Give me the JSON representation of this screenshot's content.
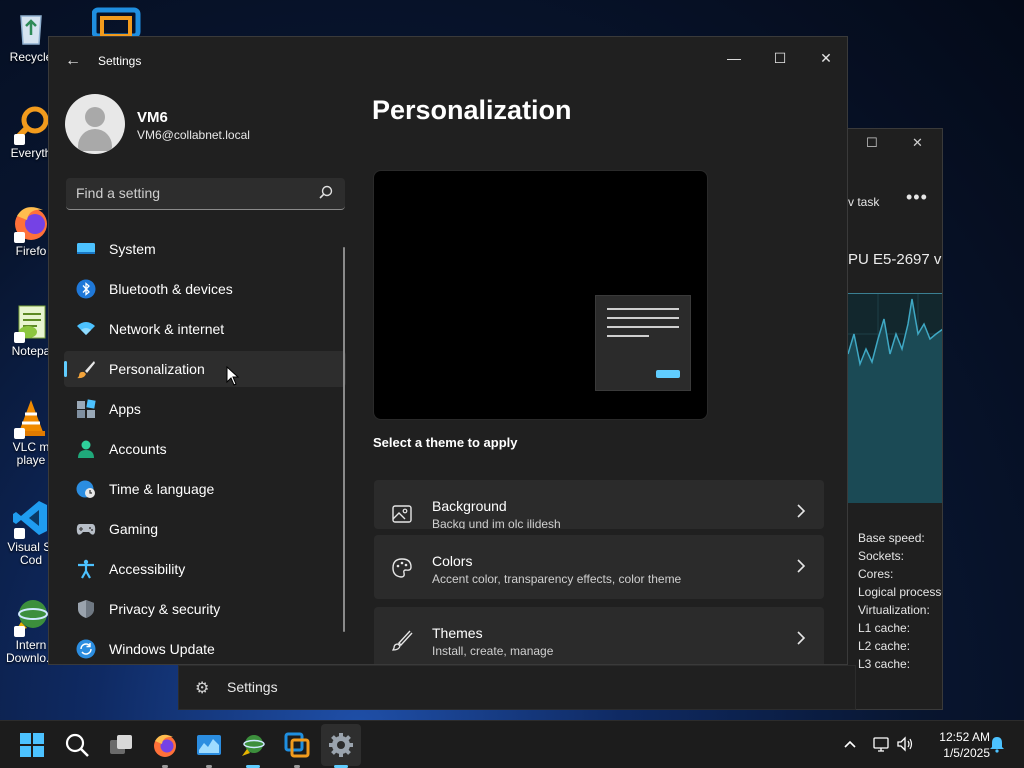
{
  "desktop": {
    "icons": [
      {
        "label": "Recycle"
      },
      {
        "label": "Everyth"
      },
      {
        "label": "Firefo"
      },
      {
        "label": "Notepa"
      },
      {
        "label": "VLC m playe"
      },
      {
        "label": "Visual St Cod"
      },
      {
        "label": "Intern Downlo..."
      }
    ]
  },
  "task_manager": {
    "new_task": "v task",
    "more": "•••",
    "cpu_name": "PU E5-2697 v",
    "specs": [
      "Base speed:",
      "Sockets:",
      "Cores:",
      "Logical processo",
      "Virtualization:",
      "L1 cache:",
      "L2 cache:",
      "L3 cache:"
    ]
  },
  "background_search": {
    "text": "Settings"
  },
  "settings": {
    "title": "Settings",
    "profile": {
      "name": "VM6",
      "email": "VM6@collabnet.local"
    },
    "search": {
      "placeholder": "Find a setting"
    },
    "nav": [
      {
        "label": "System",
        "icon": "monitor-icon"
      },
      {
        "label": "Bluetooth & devices",
        "icon": "bluetooth-icon"
      },
      {
        "label": "Network & internet",
        "icon": "wifi-icon"
      },
      {
        "label": "Personalization",
        "icon": "paintbrush-icon",
        "active": true
      },
      {
        "label": "Apps",
        "icon": "apps-icon"
      },
      {
        "label": "Accounts",
        "icon": "person-icon"
      },
      {
        "label": "Time & language",
        "icon": "globe-clock-icon"
      },
      {
        "label": "Gaming",
        "icon": "gamepad-icon"
      },
      {
        "label": "Accessibility",
        "icon": "accessibility-icon"
      },
      {
        "label": "Privacy & security",
        "icon": "shield-icon"
      },
      {
        "label": "Windows Update",
        "icon": "update-icon"
      }
    ],
    "page_title": "Personalization",
    "theme_hint": "Select a theme to apply",
    "cards": [
      {
        "title": "Background",
        "subtitle": "Backg   und im       olc   ilidesh",
        "icon": "image-icon"
      },
      {
        "title": "Colors",
        "subtitle": "Accent color, transparency effects, color theme",
        "icon": "palette-icon"
      },
      {
        "title": "Themes",
        "subtitle": "Install, create, manage",
        "icon": "brush-icon"
      }
    ]
  },
  "taskbar": {
    "time": "12:52 AM",
    "date": "1/5/2025"
  },
  "colors": {
    "accent": "#60cdff",
    "window_bg": "#202020",
    "card_bg": "#2b2b2b"
  }
}
